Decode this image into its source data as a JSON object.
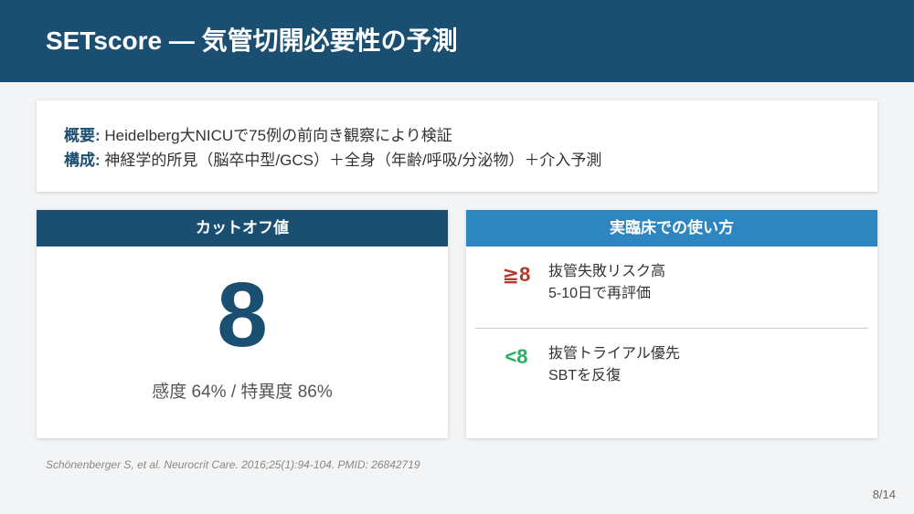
{
  "header": {
    "title": "SETscore — 気管切開必要性の予測"
  },
  "summary": {
    "overview_label": "概要:",
    "overview_text": " Heidelberg大NICUで75例の前向き観察により検証",
    "composition_label": "構成:",
    "composition_text": " 神経学的所見（脳卒中型/GCS）＋全身（年齢/呼吸/分泌物）＋介入予測"
  },
  "cutoff": {
    "title": "カットオフ値",
    "value": "8",
    "stats": "感度  64% / 特異度  86%"
  },
  "usage": {
    "title": "実臨床での使い方",
    "items": [
      {
        "symbol": "≧8",
        "line1": "抜管失敗リスク高",
        "line2": "5-10日で再評価"
      },
      {
        "symbol": "<8",
        "line1": "抜管トライアル優先",
        "line2": "SBTを反復"
      }
    ]
  },
  "citation": "Schönenberger S, et al. Neurocrit Care. 2016;25(1):94-104. PMID: 26842719",
  "page": "8/14",
  "colors": {
    "primary": "#1b4f72",
    "accent": "#2e86c1",
    "danger": "#b03a2e",
    "success": "#27ae60",
    "background": "#f2f4f6"
  }
}
